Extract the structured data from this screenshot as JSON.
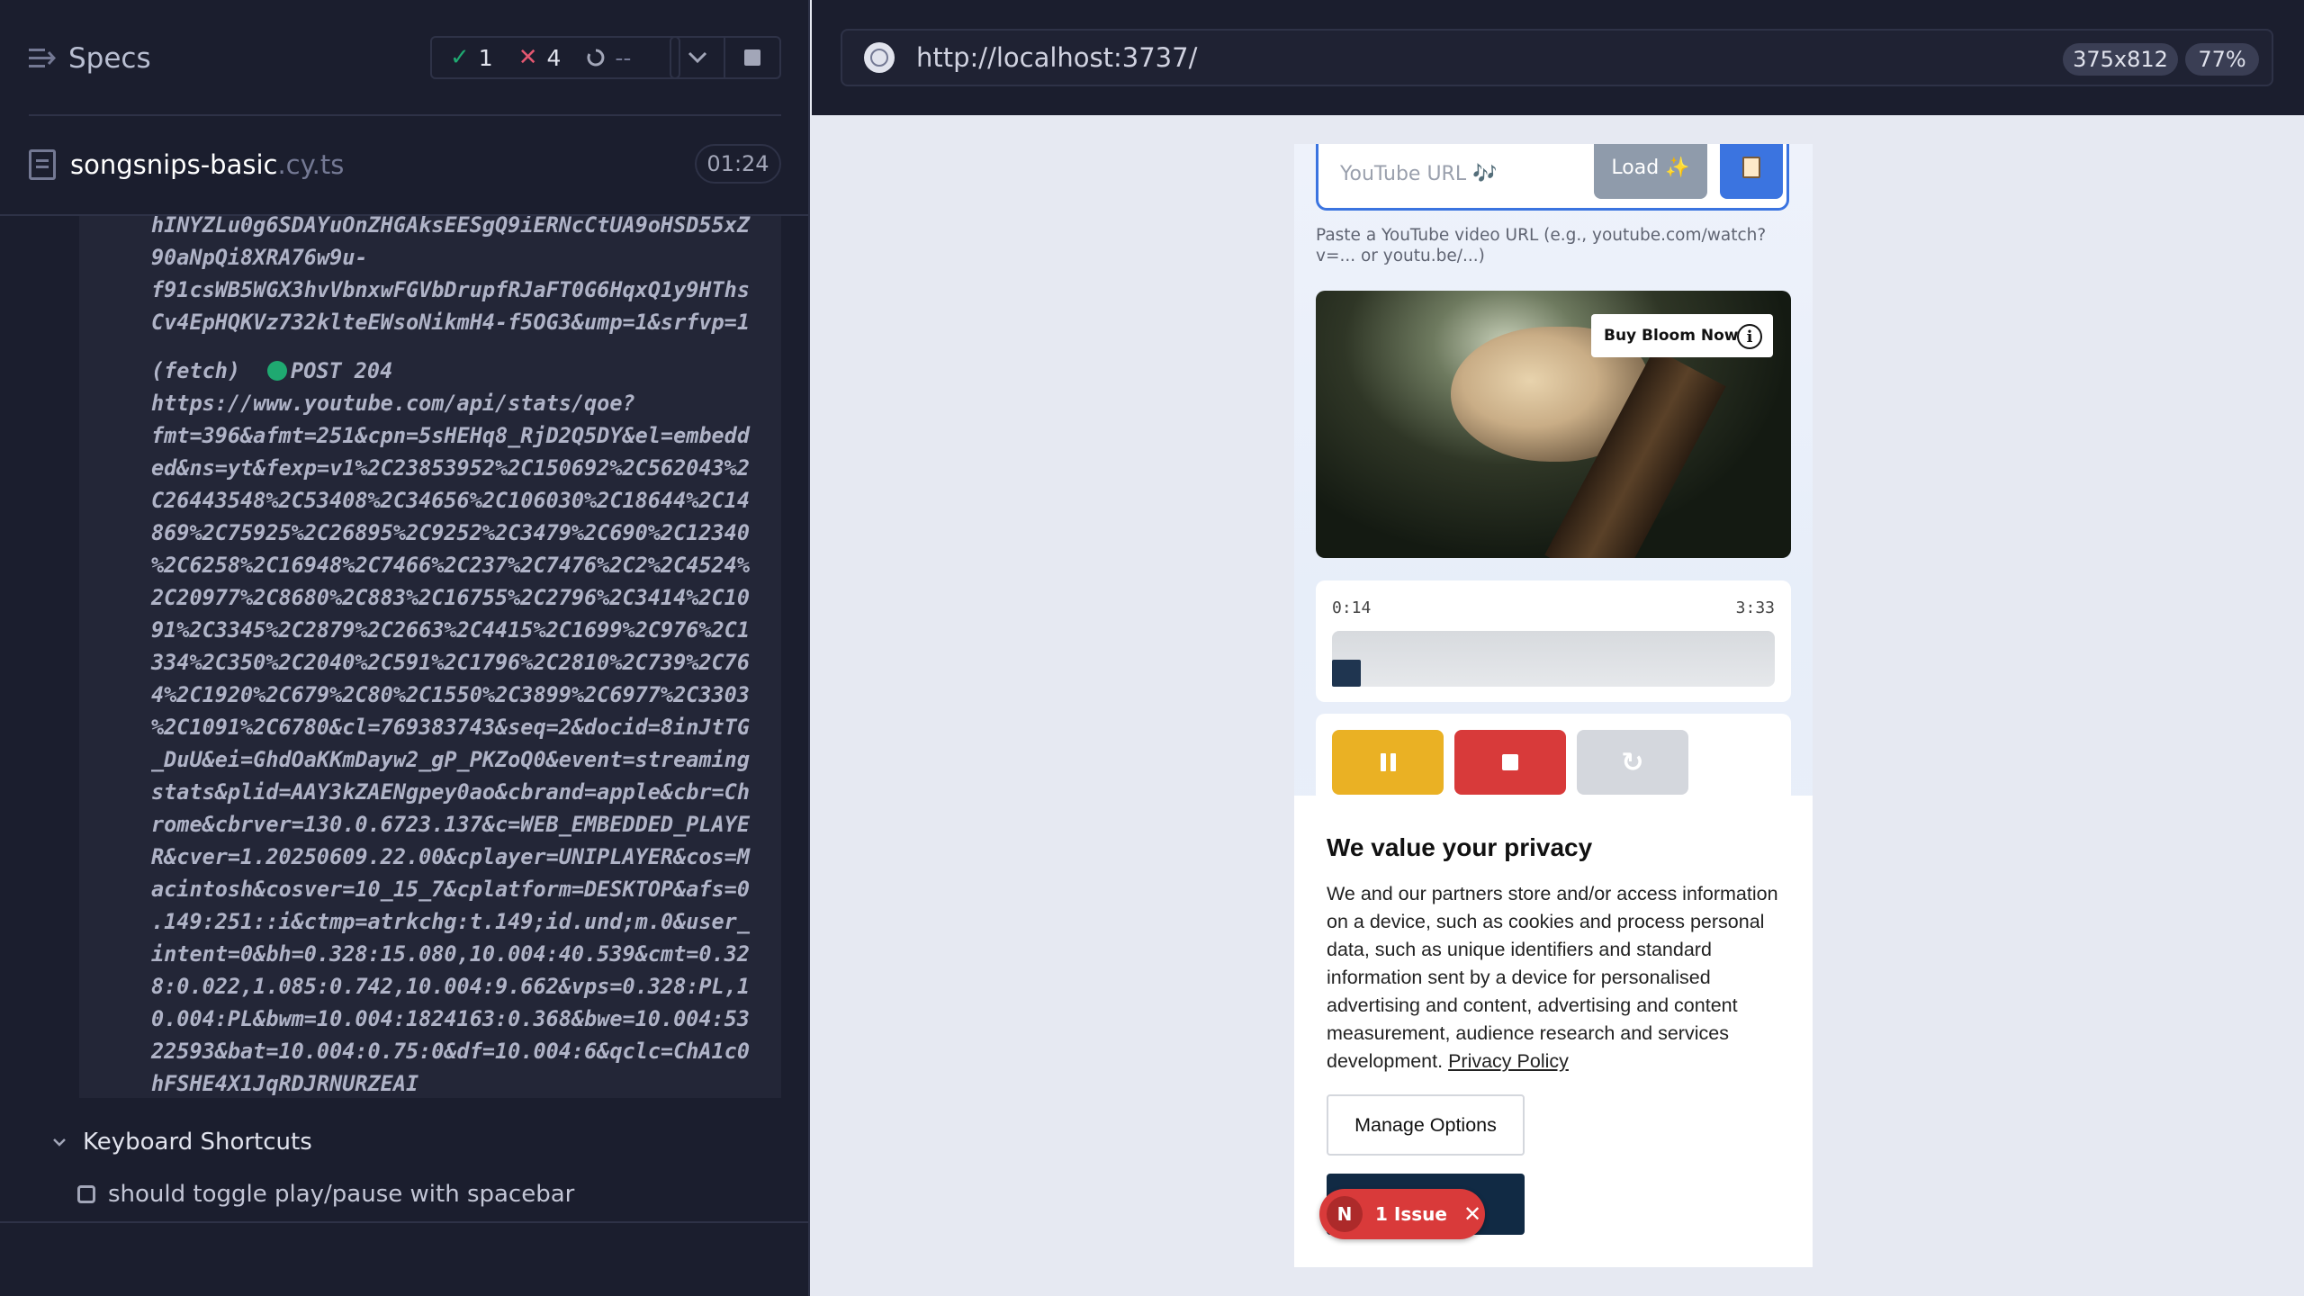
{
  "runner": {
    "title": "Specs",
    "stats": {
      "passed": "1",
      "failed": "4",
      "pending": "--"
    },
    "spec": {
      "name": "songsnips-basic",
      "ext": ".cy.ts",
      "duration": "01:24"
    },
    "log_lines_a": [
      "hINYZLu0g6SDAYuOnZHGAksEESgQ9iERNcCtUA9oHSD55xZ",
      "90aNpQi8XRA76w9u-",
      "f91csWB5WGX3hvVbnxwFGVbDrupfRJaFT0G6HqxQ1y9HThs",
      "Cv4EpHQKVz732klteEWsoNikmH4-f5OG3&ump=1&srfvp=1"
    ],
    "fetch_label": "(fetch)",
    "fetch_status": "POST 204",
    "log_lines_b": [
      "https://www.youtube.com/api/stats/qoe?",
      "fmt=396&afmt=251&cpn=5sHEHq8_RjD2Q5DY&el=embedd",
      "ed&ns=yt&fexp=v1%2C23853952%2C150692%2C562043%2",
      "C26443548%2C53408%2C34656%2C106030%2C18644%2C14",
      "869%2C75925%2C26895%2C9252%2C3479%2C690%2C12340",
      "%2C6258%2C16948%2C7466%2C237%2C7476%2C2%2C4524%",
      "2C20977%2C8680%2C883%2C16755%2C2796%2C3414%2C10",
      "91%2C3345%2C2879%2C2663%2C4415%2C1699%2C976%2C1",
      "334%2C350%2C2040%2C591%2C1796%2C2810%2C739%2C76",
      "4%2C1920%2C679%2C80%2C1550%2C3899%2C6977%2C3303",
      "%2C1091%2C6780&cl=769383743&seq=2&docid=8inJtTG",
      "_DuU&ei=GhdOaKKmDayw2_gP_PKZoQ0&event=streaming",
      "stats&plid=AAY3kZAENgpey0ao&cbrand=apple&cbr=Ch",
      "rome&cbrver=130.0.6723.137&c=WEB_EMBEDDED_PLAYE",
      "R&cver=1.20250609.22.00&cplayer=UNIPLAYER&cos=M",
      "acintosh&cosver=10_15_7&cplatform=DESKTOP&afs=0",
      ".149:251::i&ctmp=atrkchg:t.149;id.und;m.0&user_",
      "intent=0&bh=0.328:15.080,10.004:40.539&cmt=0.32",
      "8:0.022,1.085:0.742,10.004:9.662&vps=0.328:PL,1",
      "0.004:PL&bwm=10.004:1824163:0.368&bwe=10.004:53",
      "22593&bat=10.004:0.75:0&df=10.004:6&qclc=ChA1c0",
      "hFSHE4X1JqRDJRNURZEAI"
    ],
    "suite_label": "Keyboard Shortcuts",
    "test_label": "should toggle play/pause with spacebar"
  },
  "browser": {
    "url": "http://localhost:3737/",
    "viewport_size": "375x812",
    "zoom": "77%"
  },
  "app": {
    "url_placeholder": "YouTube URL 🎶",
    "load_label": "Load ✨",
    "hint": "Paste a YouTube video URL (e.g., youtube.com/watch?v=... or youtu.be/...)",
    "video": {
      "ad_label": "Buy Bloom Now",
      "info_glyph": "i"
    },
    "player": {
      "current_time": "0:14",
      "total_time": "3:33",
      "progress_percent": 6.6
    },
    "reset_glyph": "↻"
  },
  "privacy": {
    "title": "We value your privacy",
    "body": "We and our partners store and/or access information on a device, such as cookies and process personal data, such as unique identifiers and standard information sent by a device for personalised advertising and content, advertising and content measurement, audience research and services development. ",
    "policy_link": "Privacy Policy",
    "manage_label": "Manage Options"
  },
  "issues": {
    "badge": "N",
    "label": "1 Issue",
    "close": "✕"
  }
}
